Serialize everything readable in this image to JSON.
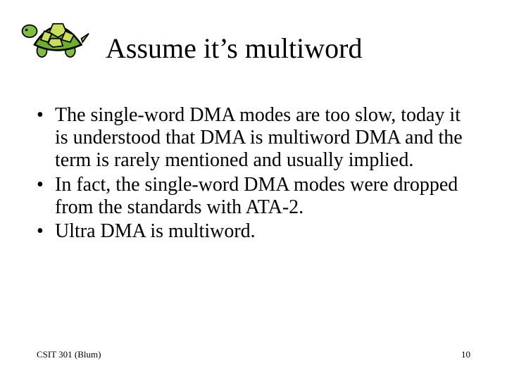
{
  "title": "Assume it’s multiword",
  "bullets": [
    "The single-word DMA modes are too slow, today it is understood that DMA is multiword DMA and the term is rarely mentioned and usually implied.",
    "In fact, the single-word DMA modes were dropped from the standards with ATA-2.",
    "Ultra DMA is multiword."
  ],
  "footer": {
    "left": "CSIT 301 (Blum)",
    "page": "10"
  }
}
